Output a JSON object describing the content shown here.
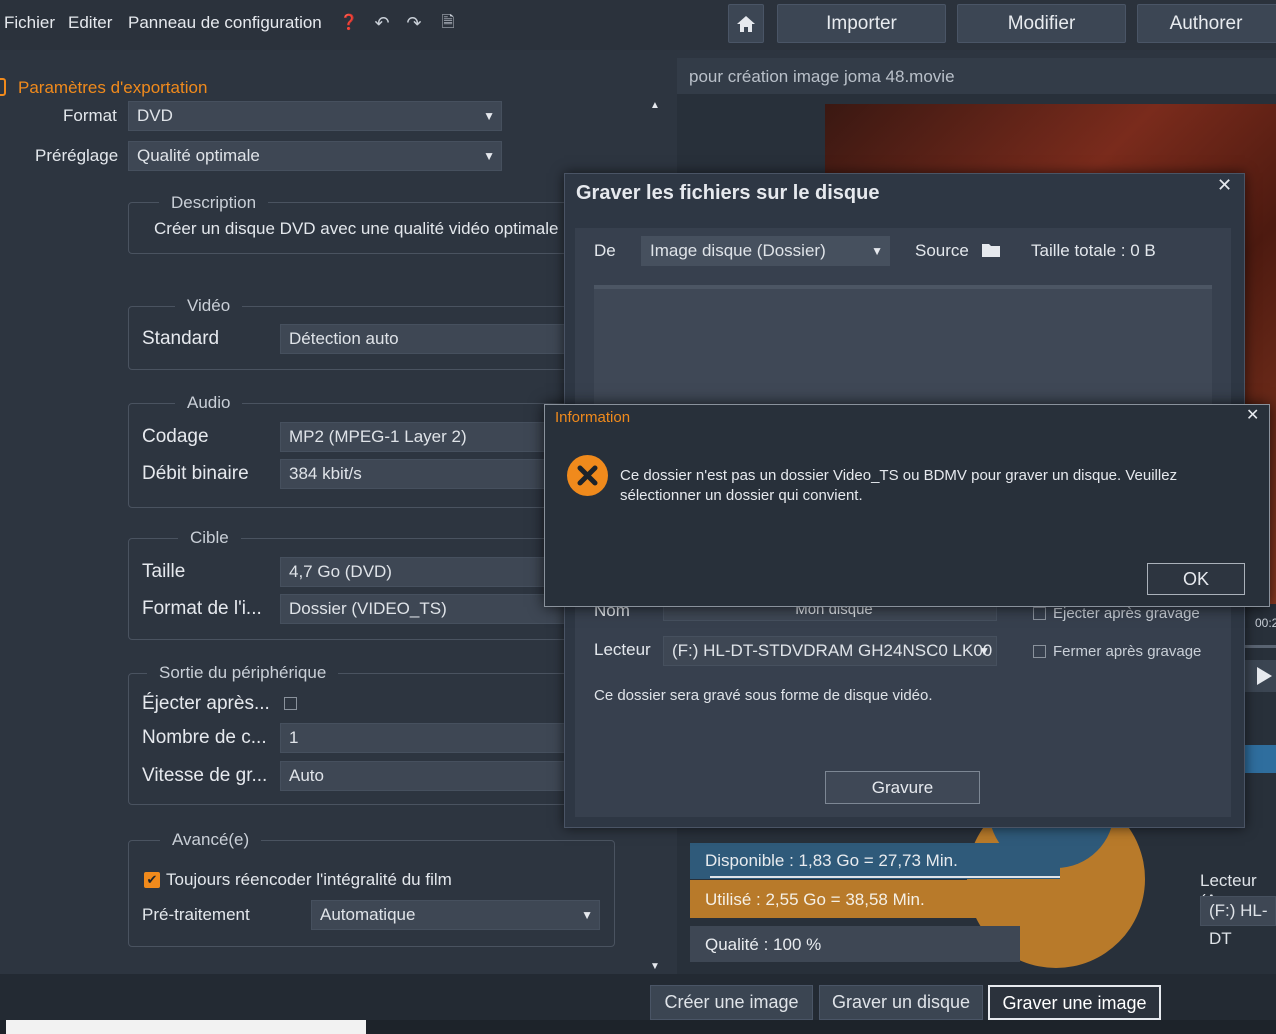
{
  "menu": {
    "fichier": "Fichier",
    "editer": "Editer",
    "panneau": "Panneau de configuration"
  },
  "top_tabs": {
    "importer": "Importer",
    "modifier": "Modifier",
    "authorer": "Authorer"
  },
  "export": {
    "section_title": "Paramètres d'exportation",
    "format_label": "Format",
    "format_value": "DVD",
    "preset_label": "Préréglage",
    "preset_value": "Qualité optimale",
    "description_title": "Description",
    "description_text": "Créer un disque DVD avec une qualité vidéo optimale",
    "video": {
      "title": "Vidéo",
      "standard_label": "Standard",
      "standard_value": "Détection auto"
    },
    "audio": {
      "title": "Audio",
      "codec_label": "Codage",
      "codec_value": "MP2 (MPEG-1 Layer 2)",
      "bitrate_label": "Débit binaire",
      "bitrate_value": "384 kbit/s"
    },
    "target": {
      "title": "Cible",
      "size_label": "Taille",
      "size_value": "4,7 Go (DVD)",
      "image_format_label": "Format de l'i...",
      "image_format_value": "Dossier (VIDEO_TS)"
    },
    "device": {
      "title": "Sortie du périphérique",
      "eject_label": "Éjecter après...",
      "copies_label": "Nombre de c...",
      "copies_value": "1",
      "speed_label": "Vitesse de gr...",
      "speed_value": "Auto"
    },
    "advanced": {
      "title": "Avancé(e)",
      "reencode_label": "Toujours réencoder l'intégralité du film",
      "pre_label": "Pré-traitement",
      "pre_value": "Automatique"
    }
  },
  "project": {
    "title": "pour création image joma 48.movie",
    "timecode": "00:2"
  },
  "disk_usage": {
    "available": "Disponible : 1,83 Go = 27,73 Min.",
    "used": "Utilisé : 2,55 Go = 38,58 Min.",
    "quality": "Qualité :  100 %",
    "used_fraction": 0.58,
    "drive_label": "Lecteur (A",
    "drive_value": "(F:) HL-DT"
  },
  "burn_dialog": {
    "title": "Graver les fichiers sur le disque",
    "from_label": "De",
    "from_value": "Image disque (Dossier)",
    "source_label": "Source",
    "total_size": "Taille totale : 0 B",
    "name_label": "Nom",
    "name_value": "Mon disque",
    "eject_label": "Éjecter après gravage",
    "drive_label": "Lecteur",
    "drive_value": "(F:) HL-DT-STDVDRAM GH24NSC0 LK00",
    "close_label": "Fermer après gravage",
    "note": "Ce dossier sera gravé sous forme de disque vidéo.",
    "burn_button": "Gravure"
  },
  "info_dialog": {
    "title": "Information",
    "message": "Ce dossier n'est pas un dossier Video_TS ou BDMV pour graver un disque. Veuillez sélectionner un dossier qui convient.",
    "ok_button": "OK"
  },
  "bottom_buttons": {
    "create_image": "Créer une image",
    "burn_disc": "Graver un disque",
    "burn_image": "Graver une image"
  },
  "colors": {
    "accent": "#f08a1c",
    "available_bar": "#2f5a7a",
    "used_bar": "#b87a2a"
  }
}
